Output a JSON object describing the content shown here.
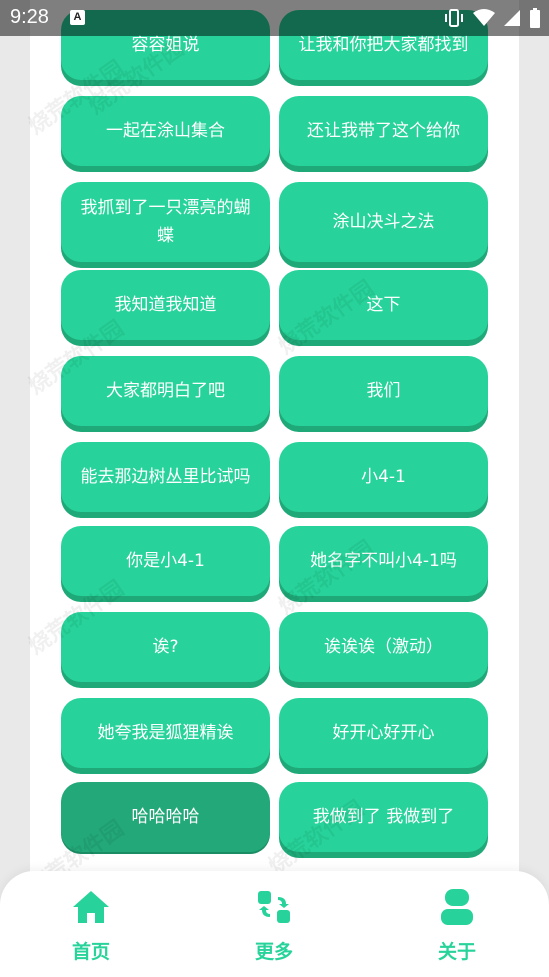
{
  "status": {
    "time": "9:28",
    "notification_badge": "A"
  },
  "tiles": [
    {
      "label": "容容姐说"
    },
    {
      "label": "让我和你把大家都找到"
    },
    {
      "label": "一起在涂山集合"
    },
    {
      "label": "还让我带了这个给你"
    },
    {
      "label": "我抓到了一只漂亮的蝴蝶"
    },
    {
      "label": "涂山决斗之法"
    },
    {
      "label": "我知道我知道"
    },
    {
      "label": "这下"
    },
    {
      "label": "大家都明白了吧"
    },
    {
      "label": "我们"
    },
    {
      "label": "能去那边树丛里比试吗"
    },
    {
      "label": "小4-1"
    },
    {
      "label": "你是小4-1"
    },
    {
      "label": "她名字不叫小4-1吗"
    },
    {
      "label": "诶?"
    },
    {
      "label": "诶诶诶（激动）"
    },
    {
      "label": "她夸我是狐狸精诶"
    },
    {
      "label": "好开心好开心"
    },
    {
      "label": "哈哈哈哈",
      "pressed": true
    },
    {
      "label": "我做到了 我做到了"
    }
  ],
  "watermark_text": "烧荒软件园",
  "nav": {
    "home_label": "首页",
    "more_label": "更多",
    "about_label": "关于"
  },
  "colors": {
    "accent": "#27d39a",
    "accent_shadow": "#1fa878",
    "pressed": "#23a879"
  },
  "icons": {
    "home": "home-icon",
    "more": "swap-grid-icon",
    "about": "person-icon"
  }
}
